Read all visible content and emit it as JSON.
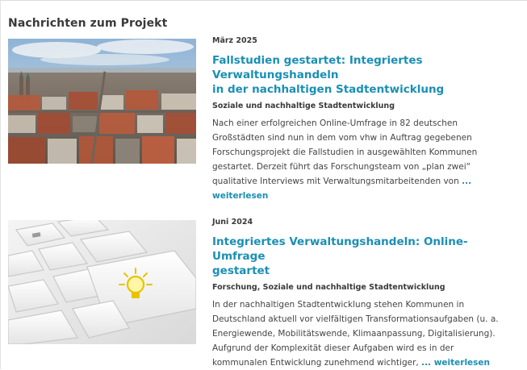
{
  "section": {
    "title": "Nachrichten zum Projekt"
  },
  "news": [
    {
      "date": "März 2025",
      "headline_line1": "Fallstudien gestartet: Integriertes Verwaltungshandeln",
      "headline_line2": "in der nachhaltigen Stadtentwicklung",
      "category": "Soziale und nachhaltige Stadtentwicklung",
      "body_lines": [
        "Nach einer erfolgreichen Online-Umfrage in 82 deutschen",
        "Großstädten sind nun in dem vom vhw in Auftrag gegebenen",
        "Forschungsprojekt die Fallstudien in ausgewählten Kommunen",
        "gestartet. Derzeit führt das Forschungsteam von „plan zwei“",
        "qualitative Interviews mit Verwaltungsmitarbeitenden von"
      ],
      "readmore_part1": "...",
      "readmore_part2": "weiterlesen",
      "image": "city-aerial-photo"
    },
    {
      "date": "Juni 2024",
      "headline_line1": "Integriertes Verwaltungshandeln: Online-Umfrage",
      "headline_line2": "gestartet",
      "category": "Forschung, Soziale und nachhaltige Stadtentwicklung",
      "body_lines": [
        "In der nachhaltigen Stadtentwicklung stehen Kommunen in",
        "Deutschland aktuell vor vielfältigen Transformationsaufgaben (u. a.",
        "Energiewende, Mobilitätswende, Klimaanpassung, Digitalisierung).",
        "Aufgrund der Komplexität dieser Aufgaben wird es in der",
        "kommunalen Entwicklung zunehmend wichtiger,"
      ],
      "readmore": "... weiterlesen",
      "image": "keyboard-lightbulb-photo"
    }
  ]
}
